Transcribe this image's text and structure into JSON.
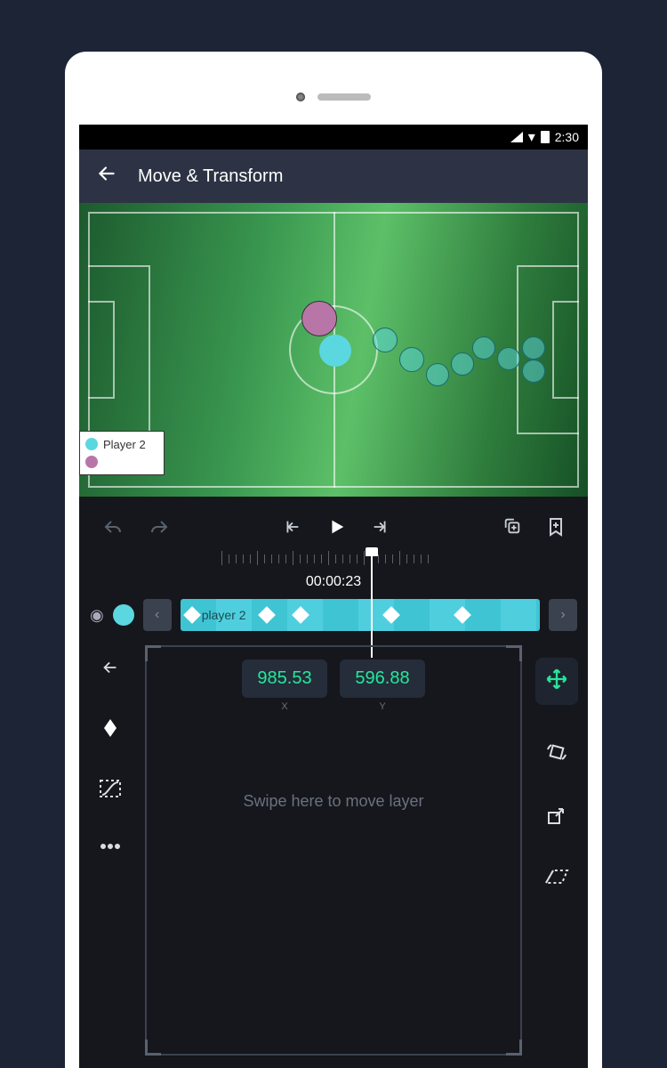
{
  "status": {
    "time": "2:30"
  },
  "header": {
    "title": "Move & Transform"
  },
  "legend": {
    "player2": "Player 2"
  },
  "timeline": {
    "timecode": "00:00:23",
    "track_label": "player 2"
  },
  "transform": {
    "x_value": "985.53",
    "y_value": "596.88",
    "x_label": "X",
    "y_label": "Y",
    "hint": "Swipe here to move layer"
  }
}
